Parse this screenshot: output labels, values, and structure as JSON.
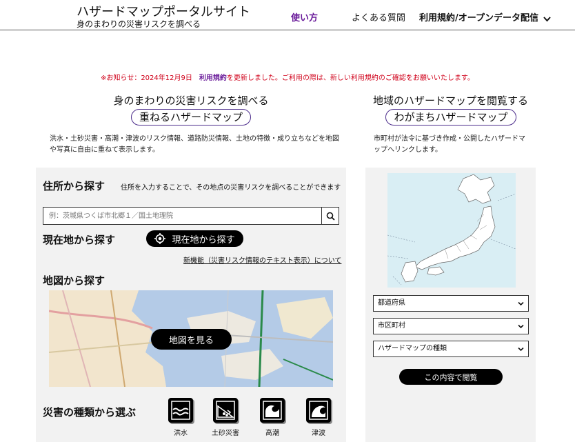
{
  "header": {
    "title": "ハザードマップポータルサイト",
    "subtitle": "身のまわりの災害リスクを調べる",
    "nav": {
      "usage": "使い方",
      "faq": "よくある質問",
      "terms": "利用規約/オープンデータ配信"
    }
  },
  "notice": {
    "prefix": "※お知らせ：2024年12月9日　",
    "link": "利用規約",
    "suffix": "を更新しました。ご利用の際は、新しい利用規約のご確認をお願いいたします。"
  },
  "left_section": {
    "title": "身のまわりの災害リスクを調べる",
    "pill": "重ねるハザードマップ",
    "description": "洪水・土砂災害・高潮・津波のリスク情報、道路防災情報、土地の特徴・成り立ちなどを地図や写真に自由に重ねて表示します。"
  },
  "right_section": {
    "title": "地域のハザードマップを閲覧する",
    "pill": "わがまちハザードマップ",
    "description": "市町村が法令に基づき作成・公開したハザードマップへリンクします。"
  },
  "address_search": {
    "heading": "住所から探す",
    "hint": "住所を入力することで、その地点の災害リスクを調べることができます",
    "placeholder": "例：茨城県つくば市北郷１／国土地理院"
  },
  "location_search": {
    "heading": "現在地から探す",
    "button": "現在地から探す",
    "new_feature_link": "新機能（災害リスク情報のテキスト表示）について"
  },
  "map_search": {
    "heading": "地図から探す",
    "button": "地図を見る"
  },
  "hazard_types": {
    "heading": "災害の種類から選ぶ",
    "items": [
      "洪水",
      "土砂災害",
      "高潮",
      "津波"
    ]
  },
  "local_map": {
    "selects": [
      "都道府県",
      "市区町村",
      "ハザードマップの種類"
    ],
    "button": "この内容で閲覧"
  },
  "colors": {
    "accent": "#6a1b9a",
    "notice": "#d0021b",
    "panel": "#f2f2f2"
  }
}
